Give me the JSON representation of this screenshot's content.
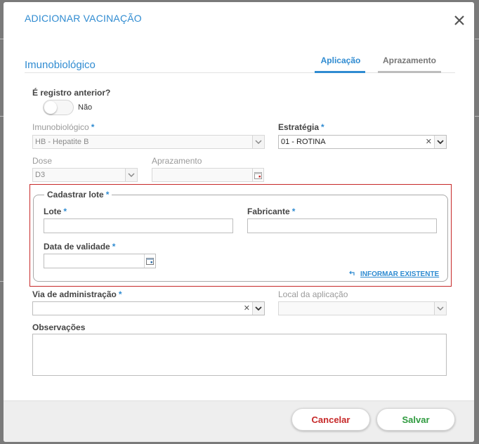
{
  "dialog": {
    "title": "ADICIONAR VACINAÇÃO",
    "close_icon": "close-icon"
  },
  "section": {
    "title": "Imunobiológico"
  },
  "tabs": [
    {
      "label": "Aplicação",
      "active": true,
      "color": "#2f8bd1"
    },
    {
      "label": "Aprazamento",
      "active": false,
      "color": "#9e9e9e"
    }
  ],
  "form": {
    "registro_anterior": {
      "label": "É registro anterior?",
      "toggle_text": "Não",
      "checked": false
    },
    "imunobiologico": {
      "label": "Imunobiológico",
      "required_mark": "*",
      "value": "HB - Hepatite B",
      "disabled": true
    },
    "estrategia": {
      "label": "Estratégia",
      "required_mark": "*",
      "value": "01 - ROTINA",
      "clear_icon": "clear-icon"
    },
    "dose": {
      "label": "Dose",
      "value": "D3",
      "disabled": true
    },
    "aprazamento": {
      "label": "Aprazamento",
      "value": "",
      "disabled": true
    },
    "cadastrar_lote": {
      "legend": "Cadastrar lote",
      "required_mark": "*",
      "lote": {
        "label": "Lote",
        "required_mark": "*",
        "value": ""
      },
      "fabricante": {
        "label": "Fabricante",
        "required_mark": "*",
        "value": ""
      },
      "data_validade": {
        "label": "Data de validade",
        "required_mark": "*",
        "value": ""
      },
      "informar_existente": {
        "label": "INFORMAR EXISTENTE",
        "icon": "return-arrow-icon"
      }
    },
    "via_administracao": {
      "label": "Via de administração",
      "required_mark": "*",
      "value": ""
    },
    "local_aplicacao": {
      "label": "Local da aplicação",
      "value": "",
      "disabled": true
    },
    "observacoes": {
      "label": "Observações",
      "value": ""
    }
  },
  "footer": {
    "cancel_label": "Cancelar",
    "save_label": "Salvar"
  },
  "colors": {
    "accent": "#2f8bd1",
    "cancel": "#c62828",
    "save": "#2e9a3e",
    "highlight_border": "#c62828"
  }
}
